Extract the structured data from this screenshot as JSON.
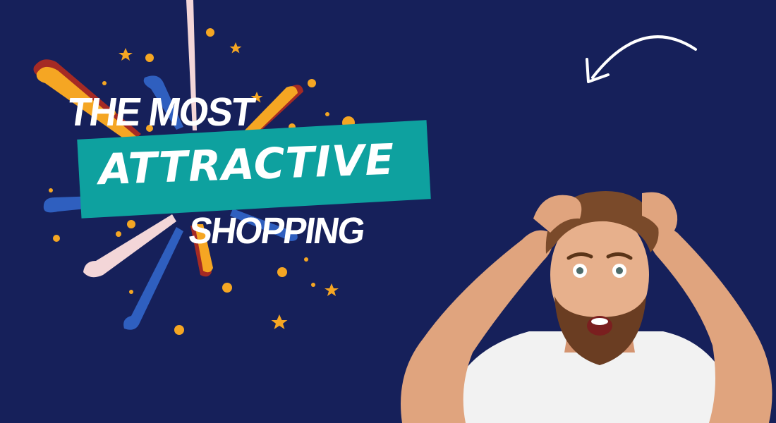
{
  "headline": {
    "line1": "THE MOST",
    "line2": "ATTRACTIVE",
    "line3": "SHOPPING"
  },
  "colors": {
    "background": "#16205a",
    "banner": "#0ea19f",
    "text": "#ffffff",
    "accent_orange": "#f5a623",
    "accent_red": "#a52a24",
    "accent_blue": "#2f5fbf",
    "accent_pink": "#f3d6d8"
  },
  "icons": [
    "curved-arrow-icon",
    "star-icon",
    "firework-burst"
  ],
  "image": {
    "subject": "surprised-man-photo"
  }
}
